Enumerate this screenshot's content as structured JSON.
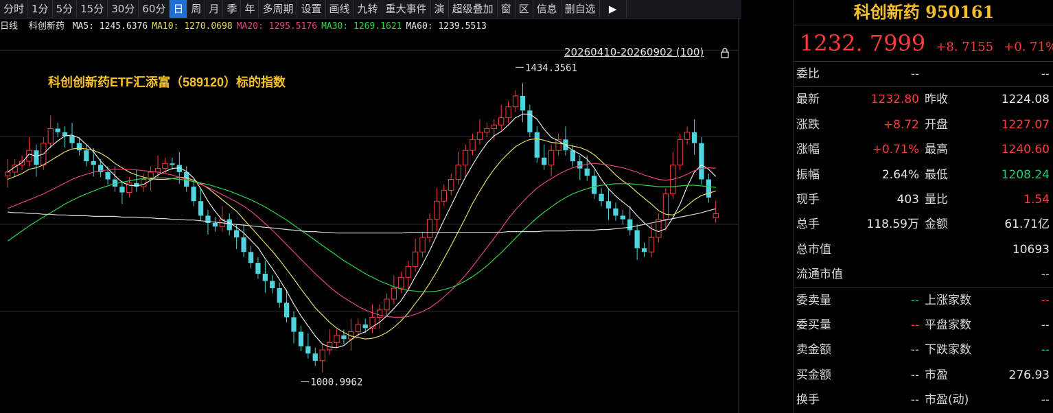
{
  "toolbar": [
    "分时",
    "1分",
    "5分",
    "15分",
    "30分",
    "60分",
    "日",
    "周",
    "月",
    "季",
    "年",
    "多周期",
    "设置",
    "画线",
    "九转",
    "重大事件",
    "演",
    "超级叠加",
    "窗",
    "区",
    "信息",
    "删自选"
  ],
  "active_tab": "日",
  "ma_bar": {
    "period": "日线",
    "name": "科创新药",
    "items": [
      {
        "label": "MA5:",
        "value": "1245.6376",
        "color": "#e6e6e6"
      },
      {
        "label": "MA10:",
        "value": "1270.0698",
        "color": "#e6d96a"
      },
      {
        "label": "MA20:",
        "value": "1295.5176",
        "color": "#e0457b"
      },
      {
        "label": "MA30:",
        "value": "1269.1621",
        "color": "#2fd14a"
      },
      {
        "label": "MA60:",
        "value": "1239.5513",
        "color": "#e6e6e6"
      }
    ]
  },
  "chart_range": "20260410-20260902 (100)",
  "annotation": "科创创新药ETF汇添富（589120）标的指数",
  "chart_data": {
    "type": "candlestick",
    "ylim": [
      958,
      1480
    ],
    "yticks": [
      1458,
      1339,
      1218,
      1098
    ],
    "high_label": "1434.3561",
    "low_label": "1000.9962",
    "high_index": 71,
    "low_index": 41,
    "closes": [
      1290,
      1300,
      1305,
      1320,
      1300,
      1330,
      1350,
      1345,
      1340,
      1330,
      1320,
      1305,
      1300,
      1290,
      1280,
      1270,
      1262,
      1275,
      1270,
      1280,
      1290,
      1295,
      1302,
      1300,
      1290,
      1270,
      1250,
      1230,
      1220,
      1215,
      1225,
      1210,
      1200,
      1180,
      1165,
      1150,
      1140,
      1130,
      1110,
      1090,
      1070,
      1050,
      1040,
      1030,
      1045,
      1055,
      1065,
      1060,
      1070,
      1080,
      1075,
      1090,
      1100,
      1115,
      1130,
      1145,
      1160,
      1180,
      1200,
      1225,
      1250,
      1265,
      1280,
      1300,
      1320,
      1335,
      1345,
      1350,
      1355,
      1365,
      1380,
      1395,
      1375,
      1345,
      1310,
      1300,
      1320,
      1335,
      1320,
      1305,
      1295,
      1285,
      1260,
      1250,
      1240,
      1230,
      1225,
      1210,
      1185,
      1180,
      1200,
      1225,
      1260,
      1300,
      1335,
      1345,
      1330,
      1280,
      1255,
      1232.8
    ],
    "candles": [
      {
        "o": 1285,
        "c": 1290
      },
      {
        "o": 1290,
        "c": 1300
      },
      {
        "o": 1300,
        "c": 1305
      },
      {
        "o": 1305,
        "c": 1320
      },
      {
        "o": 1320,
        "c": 1300
      },
      {
        "o": 1300,
        "c": 1330
      },
      {
        "o": 1330,
        "c": 1350
      },
      {
        "o": 1350,
        "c": 1345
      },
      {
        "o": 1345,
        "c": 1340
      },
      {
        "o": 1340,
        "c": 1330
      },
      {
        "o": 1330,
        "c": 1320
      },
      {
        "o": 1320,
        "c": 1305
      },
      {
        "o": 1305,
        "c": 1300
      },
      {
        "o": 1300,
        "c": 1290
      },
      {
        "o": 1290,
        "c": 1280
      },
      {
        "o": 1280,
        "c": 1270
      },
      {
        "o": 1270,
        "c": 1262
      },
      {
        "o": 1262,
        "c": 1275
      },
      {
        "o": 1275,
        "c": 1270
      },
      {
        "o": 1270,
        "c": 1280
      },
      {
        "o": 1280,
        "c": 1290
      },
      {
        "o": 1290,
        "c": 1295
      },
      {
        "o": 1295,
        "c": 1302
      },
      {
        "o": 1302,
        "c": 1300
      },
      {
        "o": 1300,
        "c": 1290
      },
      {
        "o": 1290,
        "c": 1270
      },
      {
        "o": 1270,
        "c": 1250
      },
      {
        "o": 1250,
        "c": 1230
      },
      {
        "o": 1230,
        "c": 1220
      },
      {
        "o": 1220,
        "c": 1215
      },
      {
        "o": 1215,
        "c": 1225
      },
      {
        "o": 1225,
        "c": 1210
      },
      {
        "o": 1210,
        "c": 1200
      },
      {
        "o": 1200,
        "c": 1180
      },
      {
        "o": 1180,
        "c": 1165
      },
      {
        "o": 1165,
        "c": 1150
      },
      {
        "o": 1150,
        "c": 1140
      },
      {
        "o": 1140,
        "c": 1130
      },
      {
        "o": 1130,
        "c": 1110
      },
      {
        "o": 1110,
        "c": 1090
      },
      {
        "o": 1090,
        "c": 1070
      },
      {
        "o": 1070,
        "c": 1050
      },
      {
        "o": 1050,
        "c": 1040
      },
      {
        "o": 1040,
        "c": 1030
      },
      {
        "o": 1030,
        "c": 1045
      },
      {
        "o": 1045,
        "c": 1055
      },
      {
        "o": 1055,
        "c": 1065
      },
      {
        "o": 1065,
        "c": 1060
      },
      {
        "o": 1060,
        "c": 1070
      },
      {
        "o": 1070,
        "c": 1080
      },
      {
        "o": 1080,
        "c": 1075
      },
      {
        "o": 1075,
        "c": 1090
      },
      {
        "o": 1090,
        "c": 1100
      },
      {
        "o": 1100,
        "c": 1115
      },
      {
        "o": 1115,
        "c": 1130
      },
      {
        "o": 1130,
        "c": 1145
      },
      {
        "o": 1145,
        "c": 1160
      },
      {
        "o": 1160,
        "c": 1180
      },
      {
        "o": 1180,
        "c": 1200
      },
      {
        "o": 1200,
        "c": 1225
      },
      {
        "o": 1225,
        "c": 1250
      },
      {
        "o": 1250,
        "c": 1265
      },
      {
        "o": 1265,
        "c": 1280
      },
      {
        "o": 1280,
        "c": 1300
      },
      {
        "o": 1300,
        "c": 1320
      },
      {
        "o": 1320,
        "c": 1335
      },
      {
        "o": 1335,
        "c": 1345
      },
      {
        "o": 1345,
        "c": 1350
      },
      {
        "o": 1350,
        "c": 1355
      },
      {
        "o": 1355,
        "c": 1365
      },
      {
        "o": 1365,
        "c": 1380
      },
      {
        "o": 1380,
        "c": 1395
      },
      {
        "o": 1395,
        "c": 1375
      },
      {
        "o": 1375,
        "c": 1345
      },
      {
        "o": 1345,
        "c": 1310
      },
      {
        "o": 1310,
        "c": 1300
      },
      {
        "o": 1300,
        "c": 1320
      },
      {
        "o": 1320,
        "c": 1335
      },
      {
        "o": 1335,
        "c": 1320
      },
      {
        "o": 1320,
        "c": 1305
      },
      {
        "o": 1305,
        "c": 1295
      },
      {
        "o": 1295,
        "c": 1285
      },
      {
        "o": 1285,
        "c": 1260
      },
      {
        "o": 1260,
        "c": 1250
      },
      {
        "o": 1250,
        "c": 1240
      },
      {
        "o": 1240,
        "c": 1230
      },
      {
        "o": 1230,
        "c": 1225
      },
      {
        "o": 1225,
        "c": 1210
      },
      {
        "o": 1210,
        "c": 1185
      },
      {
        "o": 1185,
        "c": 1180
      },
      {
        "o": 1180,
        "c": 1200
      },
      {
        "o": 1200,
        "c": 1225
      },
      {
        "o": 1225,
        "c": 1260
      },
      {
        "o": 1260,
        "c": 1300
      },
      {
        "o": 1300,
        "c": 1335
      },
      {
        "o": 1335,
        "c": 1345
      },
      {
        "o": 1345,
        "c": 1330
      },
      {
        "o": 1330,
        "c": 1280
      },
      {
        "o": 1280,
        "c": 1255
      },
      {
        "o": 1227.07,
        "c": 1232.8
      }
    ],
    "ma_lines": [
      {
        "name": "MA5",
        "color": "#e6e6e6",
        "values": [
          1290,
          1297,
          1303,
          1315,
          1312,
          1315,
          1325,
          1333,
          1340,
          1341,
          1337,
          1328,
          1318,
          1305,
          1295,
          1285,
          1276,
          1272,
          1271,
          1273,
          1279,
          1286,
          1291,
          1295,
          1296,
          1291,
          1282,
          1267,
          1250,
          1236,
          1224,
          1220,
          1214,
          1206,
          1196,
          1186,
          1171,
          1157,
          1142,
          1126,
          1108,
          1092,
          1078,
          1064,
          1053,
          1049,
          1048,
          1051,
          1059,
          1066,
          1070,
          1077,
          1083,
          1092,
          1102,
          1113,
          1128,
          1146,
          1163,
          1182,
          1203,
          1224,
          1244,
          1264,
          1283,
          1300,
          1316,
          1330,
          1340,
          1346,
          1355,
          1365,
          1370,
          1370,
          1363,
          1349,
          1338,
          1333,
          1327,
          1320,
          1315,
          1308,
          1296,
          1280,
          1267,
          1257,
          1249,
          1241,
          1230,
          1220,
          1212,
          1208,
          1212,
          1227,
          1246,
          1270,
          1290,
          1300,
          1294,
          1284
        ]
      },
      {
        "name": "MA10",
        "color": "#e6d96a",
        "values": [
          1280,
          1284,
          1288,
          1294,
          1296,
          1300,
          1306,
          1312,
          1318,
          1322,
          1323,
          1322,
          1320,
          1316,
          1310,
          1302,
          1296,
          1290,
          1286,
          1283,
          1281,
          1280,
          1280,
          1281,
          1283,
          1282,
          1279,
          1274,
          1268,
          1260,
          1252,
          1244,
          1236,
          1225,
          1214,
          1203,
          1192,
          1181,
          1169,
          1156,
          1143,
          1129,
          1116,
          1103,
          1093,
          1083,
          1075,
          1069,
          1064,
          1062,
          1060,
          1061,
          1064,
          1069,
          1076,
          1085,
          1096,
          1109,
          1122,
          1137,
          1153,
          1171,
          1189,
          1208,
          1227,
          1247,
          1264,
          1280,
          1294,
          1306,
          1316,
          1325,
          1331,
          1335,
          1336,
          1334,
          1331,
          1330,
          1328,
          1326,
          1324,
          1320,
          1314,
          1305,
          1296,
          1286,
          1278,
          1271,
          1262,
          1254,
          1246,
          1237,
          1232,
          1231,
          1236,
          1244,
          1252,
          1258,
          1261,
          1264
        ]
      },
      {
        "name": "MA20",
        "color": "#e0457b",
        "values": [
          1240,
          1244,
          1248,
          1252,
          1256,
          1260,
          1265,
          1270,
          1275,
          1280,
          1284,
          1287,
          1290,
          1292,
          1293,
          1294,
          1294,
          1294,
          1293,
          1292,
          1291,
          1290,
          1288,
          1286,
          1283,
          1280,
          1277,
          1273,
          1269,
          1264,
          1259,
          1254,
          1249,
          1243,
          1236,
          1228,
          1219,
          1210,
          1200,
          1190,
          1180,
          1170,
          1160,
          1150,
          1141,
          1132,
          1124,
          1117,
          1111,
          1105,
          1100,
          1096,
          1093,
          1091,
          1090,
          1090,
          1091,
          1094,
          1098,
          1103,
          1110,
          1118,
          1127,
          1137,
          1148,
          1160,
          1173,
          1186,
          1199,
          1212,
          1226,
          1238,
          1249,
          1259,
          1268,
          1275,
          1281,
          1287,
          1292,
          1296,
          1299,
          1301,
          1302,
          1301,
          1300,
          1298,
          1296,
          1293,
          1290,
          1286,
          1283,
          1280,
          1279,
          1280,
          1283,
          1287,
          1292,
          1295,
          1296,
          1295.5
        ]
      },
      {
        "name": "MA30",
        "color": "#2fd14a",
        "values": [
          1195,
          1202,
          1209,
          1216,
          1222,
          1228,
          1234,
          1240,
          1246,
          1251,
          1256,
          1260,
          1264,
          1268,
          1271,
          1274,
          1276,
          1278,
          1280,
          1281,
          1282,
          1282,
          1282,
          1281,
          1280,
          1279,
          1277,
          1275,
          1273,
          1270,
          1267,
          1264,
          1260,
          1256,
          1252,
          1247,
          1242,
          1236,
          1230,
          1224,
          1217,
          1210,
          1203,
          1196,
          1189,
          1182,
          1175,
          1168,
          1162,
          1156,
          1150,
          1145,
          1140,
          1136,
          1132,
          1129,
          1127,
          1126,
          1125,
          1125,
          1126,
          1128,
          1131,
          1135,
          1140,
          1146,
          1153,
          1161,
          1170,
          1179,
          1189,
          1199,
          1209,
          1218,
          1227,
          1235,
          1242,
          1249,
          1255,
          1260,
          1264,
          1267,
          1270,
          1272,
          1273,
          1274,
          1274,
          1274,
          1273,
          1272,
          1271,
          1270,
          1270,
          1270,
          1271,
          1272,
          1272,
          1271,
          1270,
          1269
        ]
      },
      {
        "name": "MA60",
        "color": "#d8d8d8",
        "values": [
          1235,
          1234,
          1234,
          1233,
          1233,
          1232,
          1232,
          1231,
          1231,
          1230,
          1230,
          1230,
          1229,
          1229,
          1229,
          1229,
          1228,
          1228,
          1228,
          1227,
          1227,
          1226,
          1226,
          1225,
          1225,
          1224,
          1224,
          1223,
          1222,
          1221,
          1220,
          1219,
          1218,
          1217,
          1216,
          1215,
          1214,
          1213,
          1212,
          1211,
          1210,
          1209,
          1208,
          1208,
          1207,
          1207,
          1206,
          1206,
          1206,
          1206,
          1206,
          1206,
          1206,
          1206,
          1206,
          1206,
          1207,
          1207,
          1207,
          1207,
          1207,
          1207,
          1207,
          1207,
          1207,
          1207,
          1207,
          1207,
          1207,
          1207,
          1208,
          1208,
          1208,
          1208,
          1208,
          1209,
          1209,
          1209,
          1209,
          1210,
          1210,
          1210,
          1210,
          1211,
          1211,
          1212,
          1213,
          1214,
          1216,
          1218,
          1220,
          1222,
          1224,
          1226,
          1228,
          1230,
          1232,
          1234,
          1237,
          1239.5
        ]
      }
    ]
  },
  "panel": {
    "title": "科创新药 950161",
    "price": "1232. 7999",
    "change": "+8. 7155",
    "change_pct": "+0. 71%",
    "weibi": {
      "label": "委比",
      "v1": "--",
      "v2": "--"
    },
    "rows": [
      {
        "l1": "最新",
        "v1": "1232.80",
        "c1": "red",
        "l2": "昨收",
        "v2": "1224.08",
        "c2": "white"
      },
      {
        "l1": "涨跌",
        "v1": "+8.72",
        "c1": "red",
        "l2": "开盘",
        "v2": "1227.07",
        "c2": "red"
      },
      {
        "l1": "涨幅",
        "v1": "+0.71%",
        "c1": "red",
        "l2": "最高",
        "v2": "1240.60",
        "c2": "red"
      },
      {
        "l1": "振幅",
        "v1": "2.64%",
        "c1": "white",
        "l2": "最低",
        "v2": "1208.24",
        "c2": "green"
      },
      {
        "l1": "现手",
        "v1": "403",
        "c1": "white",
        "l2": "量比",
        "v2": "1.54",
        "c2": "red"
      },
      {
        "l1": "总手",
        "v1": "118.59万",
        "c1": "white",
        "l2": "金额",
        "v2": "61.71亿",
        "c2": "white"
      },
      {
        "l1": "总市值",
        "v1": "",
        "c1": "white",
        "l2": "",
        "v2": "10693",
        "c2": "white"
      },
      {
        "l1": "流通市值",
        "v1": "",
        "c1": "white",
        "l2": "",
        "v2": "--",
        "c2": "grey"
      }
    ],
    "rows2": [
      {
        "l1": "委卖量",
        "v1": "--",
        "c1": "green",
        "l2": "上涨家数",
        "v2": "--",
        "c2": "red"
      },
      {
        "l1": "委买量",
        "v1": "--",
        "c1": "red",
        "l2": "平盘家数",
        "v2": "--",
        "c2": "grey"
      },
      {
        "l1": "卖金额",
        "v1": "--",
        "c1": "grey",
        "l2": "下跌家数",
        "v2": "--",
        "c2": "green"
      },
      {
        "l1": "买金额",
        "v1": "--",
        "c1": "grey",
        "l2": "市盈",
        "v2": "276.93",
        "c2": "white"
      },
      {
        "l1": "换手",
        "v1": "--",
        "c1": "grey",
        "l2": "市盈(动)",
        "v2": "--",
        "c2": "grey"
      }
    ]
  }
}
